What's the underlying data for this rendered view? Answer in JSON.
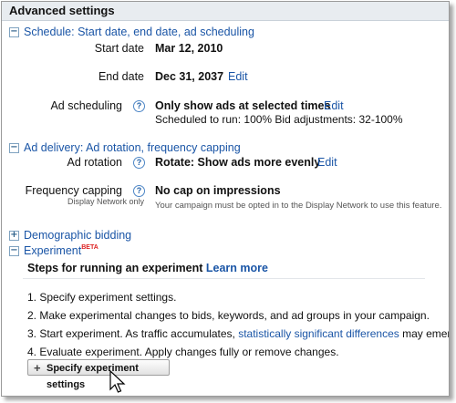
{
  "panel": {
    "title": "Advanced settings"
  },
  "schedule": {
    "section_label": "Schedule: Start date, end date, ad scheduling",
    "start_date_label": "Start date",
    "start_date_value": "Mar 12, 2010",
    "end_date_label": "End date",
    "end_date_value": "Dec 31, 2037",
    "end_date_edit": "Edit",
    "ad_scheduling_label": "Ad scheduling",
    "ad_scheduling_value": "Only show ads at selected times",
    "ad_scheduling_edit": "Edit",
    "ad_scheduling_detail": "Scheduled to run: 100% Bid adjustments: 32-100%"
  },
  "delivery": {
    "section_label": "Ad delivery: Ad rotation, frequency capping",
    "ad_rotation_label": "Ad rotation",
    "ad_rotation_value": "Rotate: Show ads more evenly",
    "ad_rotation_edit": "Edit",
    "freq_label": "Frequency capping",
    "freq_sublabel": "Display Network only",
    "freq_value": "No cap on impressions",
    "freq_note": "Your campaign must be opted in to the Display Network to use this feature."
  },
  "demographic": {
    "section_label": "Demographic bidding"
  },
  "experiment": {
    "section_label": "Experiment",
    "beta": "BETA",
    "steps_heading": "Steps for running an experiment",
    "learn_more": "Learn more",
    "step1": "1. Specify experiment settings.",
    "step2": "2. Make experimental changes to bids, keywords, and ad groups in your campaign.",
    "step3_prefix": "3. Start experiment. As traffic accumulates, ",
    "step3_link": "statistically significant differences",
    "step3_suffix": " may emerge.",
    "step4": "4. Evaluate experiment. Apply changes fully or remove changes.",
    "button_label": "Specify experiment settings"
  },
  "icons": {
    "minus": "−",
    "plus": "+",
    "help": "?"
  }
}
